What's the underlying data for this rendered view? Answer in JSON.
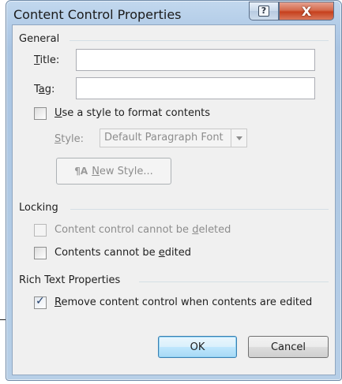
{
  "window": {
    "title": "Content Control Properties"
  },
  "titlebar": {
    "help_icon": "question-mark-icon",
    "close_icon": "close-x-icon",
    "close_glyph": "X",
    "help_glyph": "?"
  },
  "general": {
    "heading": "General",
    "title_label": {
      "key": "T",
      "rest": "itle:"
    },
    "title_value": "",
    "tag_label": {
      "pre": "T",
      "key": "a",
      "rest": "g:"
    },
    "tag_value": "",
    "use_style": {
      "key": "U",
      "rest": "se a style to format contents",
      "checked": false
    },
    "style_label": {
      "key": "S",
      "rest": "tyle:"
    },
    "style_value": "Default Paragraph Font",
    "new_style_button": {
      "icon": "style-icon",
      "key": "N",
      "rest": "ew Style..."
    }
  },
  "locking": {
    "heading": "Locking",
    "cannot_delete": {
      "pre": "Content control cannot be ",
      "key": "d",
      "rest": "eleted",
      "checked": false
    },
    "cannot_edit": {
      "pre": "Contents cannot be ",
      "key": "e",
      "rest": "dited",
      "checked": false
    }
  },
  "rich_text": {
    "heading": "Rich Text Properties",
    "remove_control": {
      "key": "R",
      "rest": "emove content control when contents are edited",
      "checked": true
    }
  },
  "buttons": {
    "ok": "OK",
    "cancel": "Cancel"
  }
}
